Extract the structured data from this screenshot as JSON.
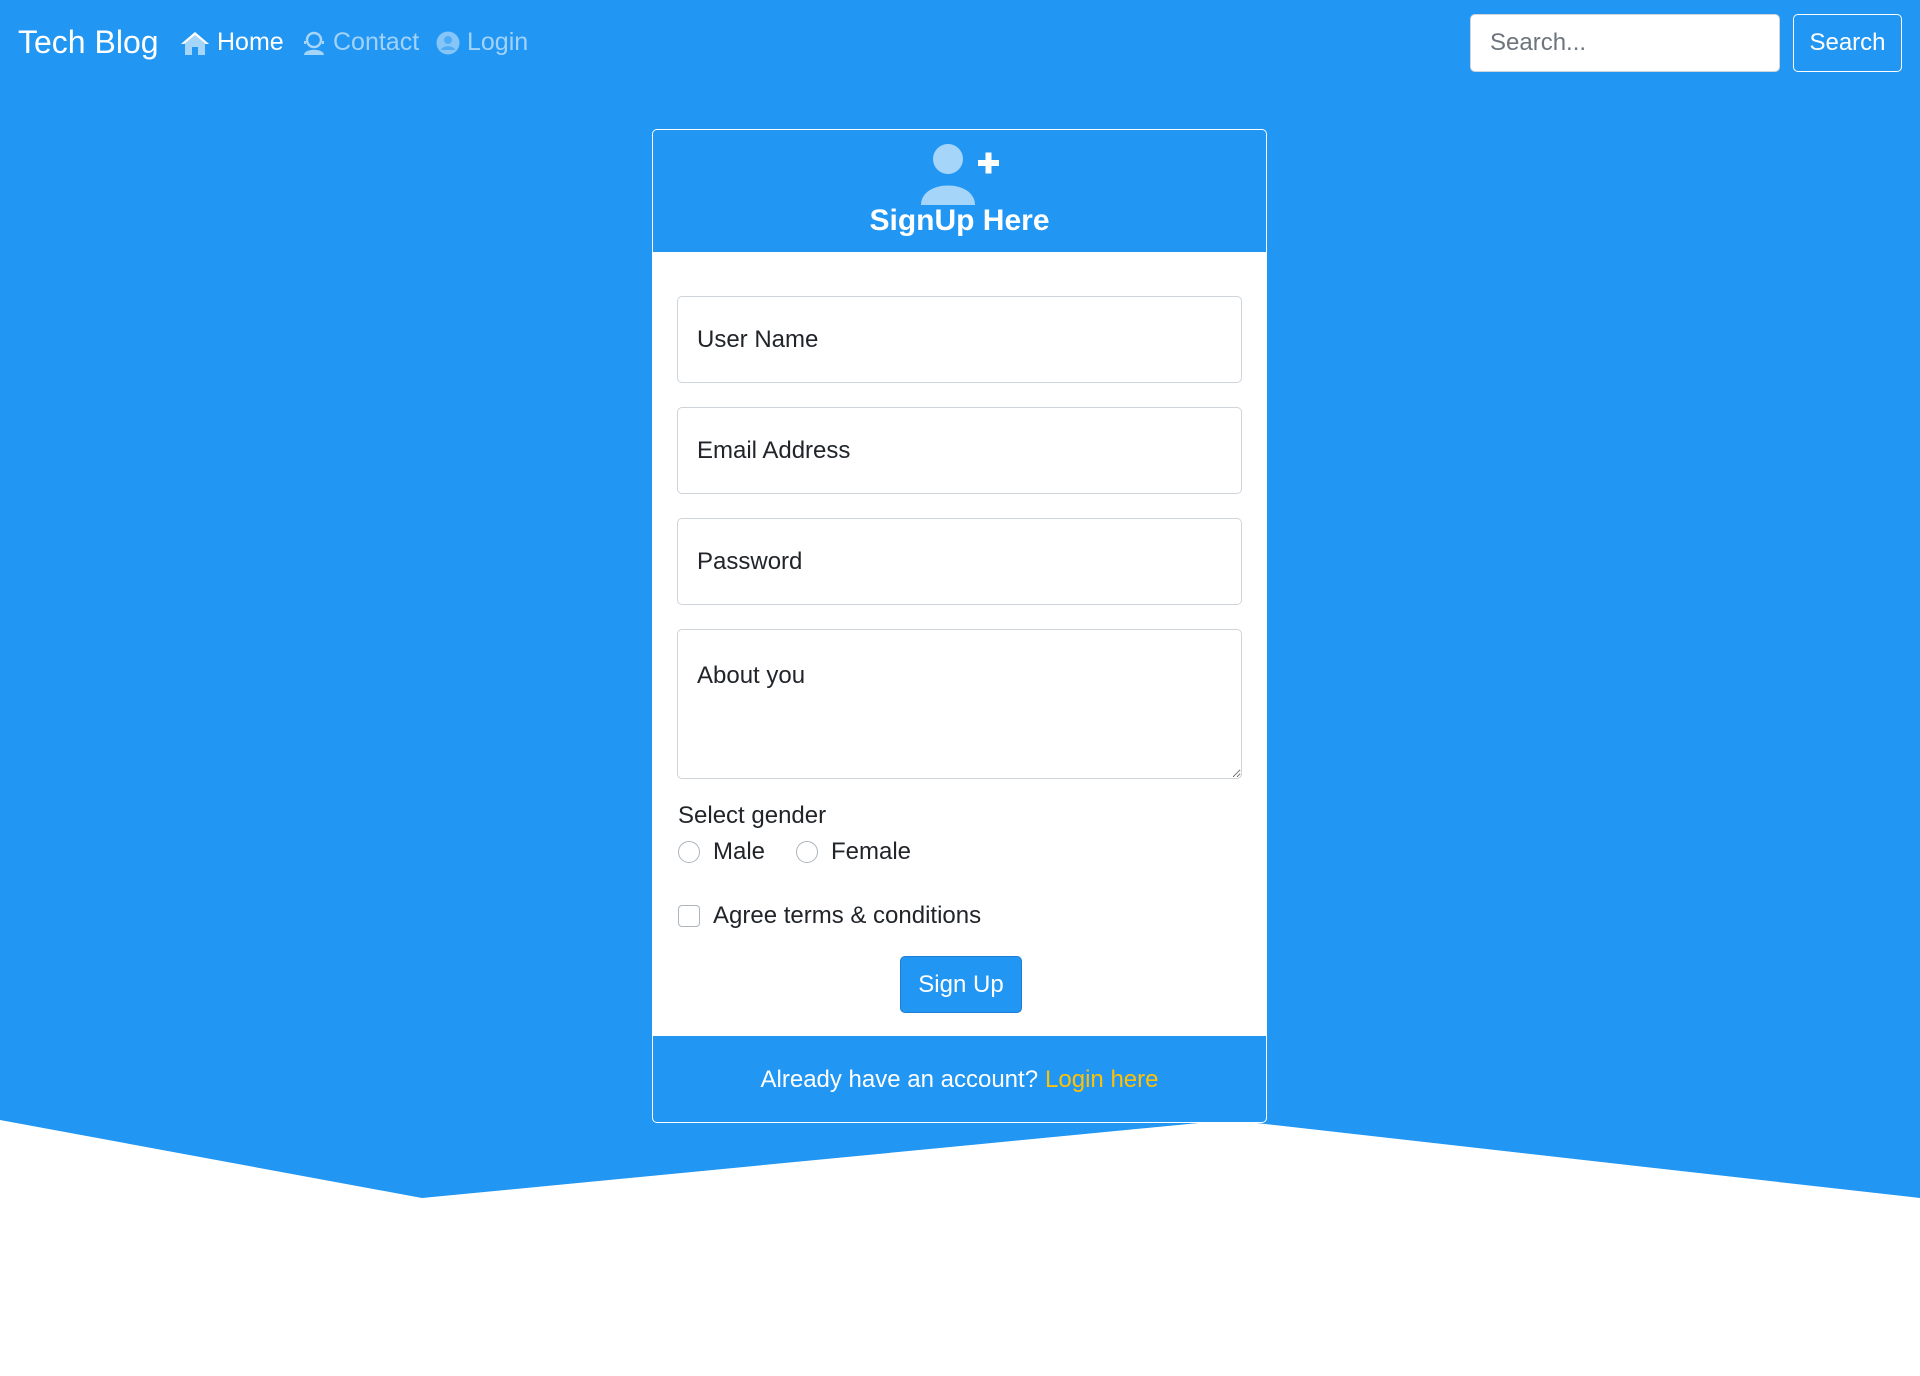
{
  "theme": {
    "primary": "#2196f3",
    "link_accent": "#ffc107"
  },
  "navbar": {
    "brand": "Tech Blog",
    "links": [
      {
        "label": "Home",
        "icon": "home-icon",
        "active": true
      },
      {
        "label": "Contact",
        "icon": "contact-icon",
        "active": false
      },
      {
        "label": "Login",
        "icon": "user-circle-icon",
        "active": false
      }
    ],
    "search": {
      "placeholder": "Search...",
      "button_label": "Search"
    }
  },
  "signup_card": {
    "header_icon": "user-plus-icon",
    "title": "SignUp Here",
    "fields": {
      "username_placeholder": "User Name",
      "email_placeholder": "Email Address",
      "password_placeholder": "Password",
      "about_placeholder": "About you"
    },
    "gender": {
      "label": "Select gender",
      "options": [
        "Male",
        "Female"
      ],
      "selected": null
    },
    "terms": {
      "label": "Agree terms & conditions",
      "checked": false
    },
    "submit_label": "Sign Up",
    "footer": {
      "text": "Already have an account?",
      "link_label": "Login here"
    }
  }
}
